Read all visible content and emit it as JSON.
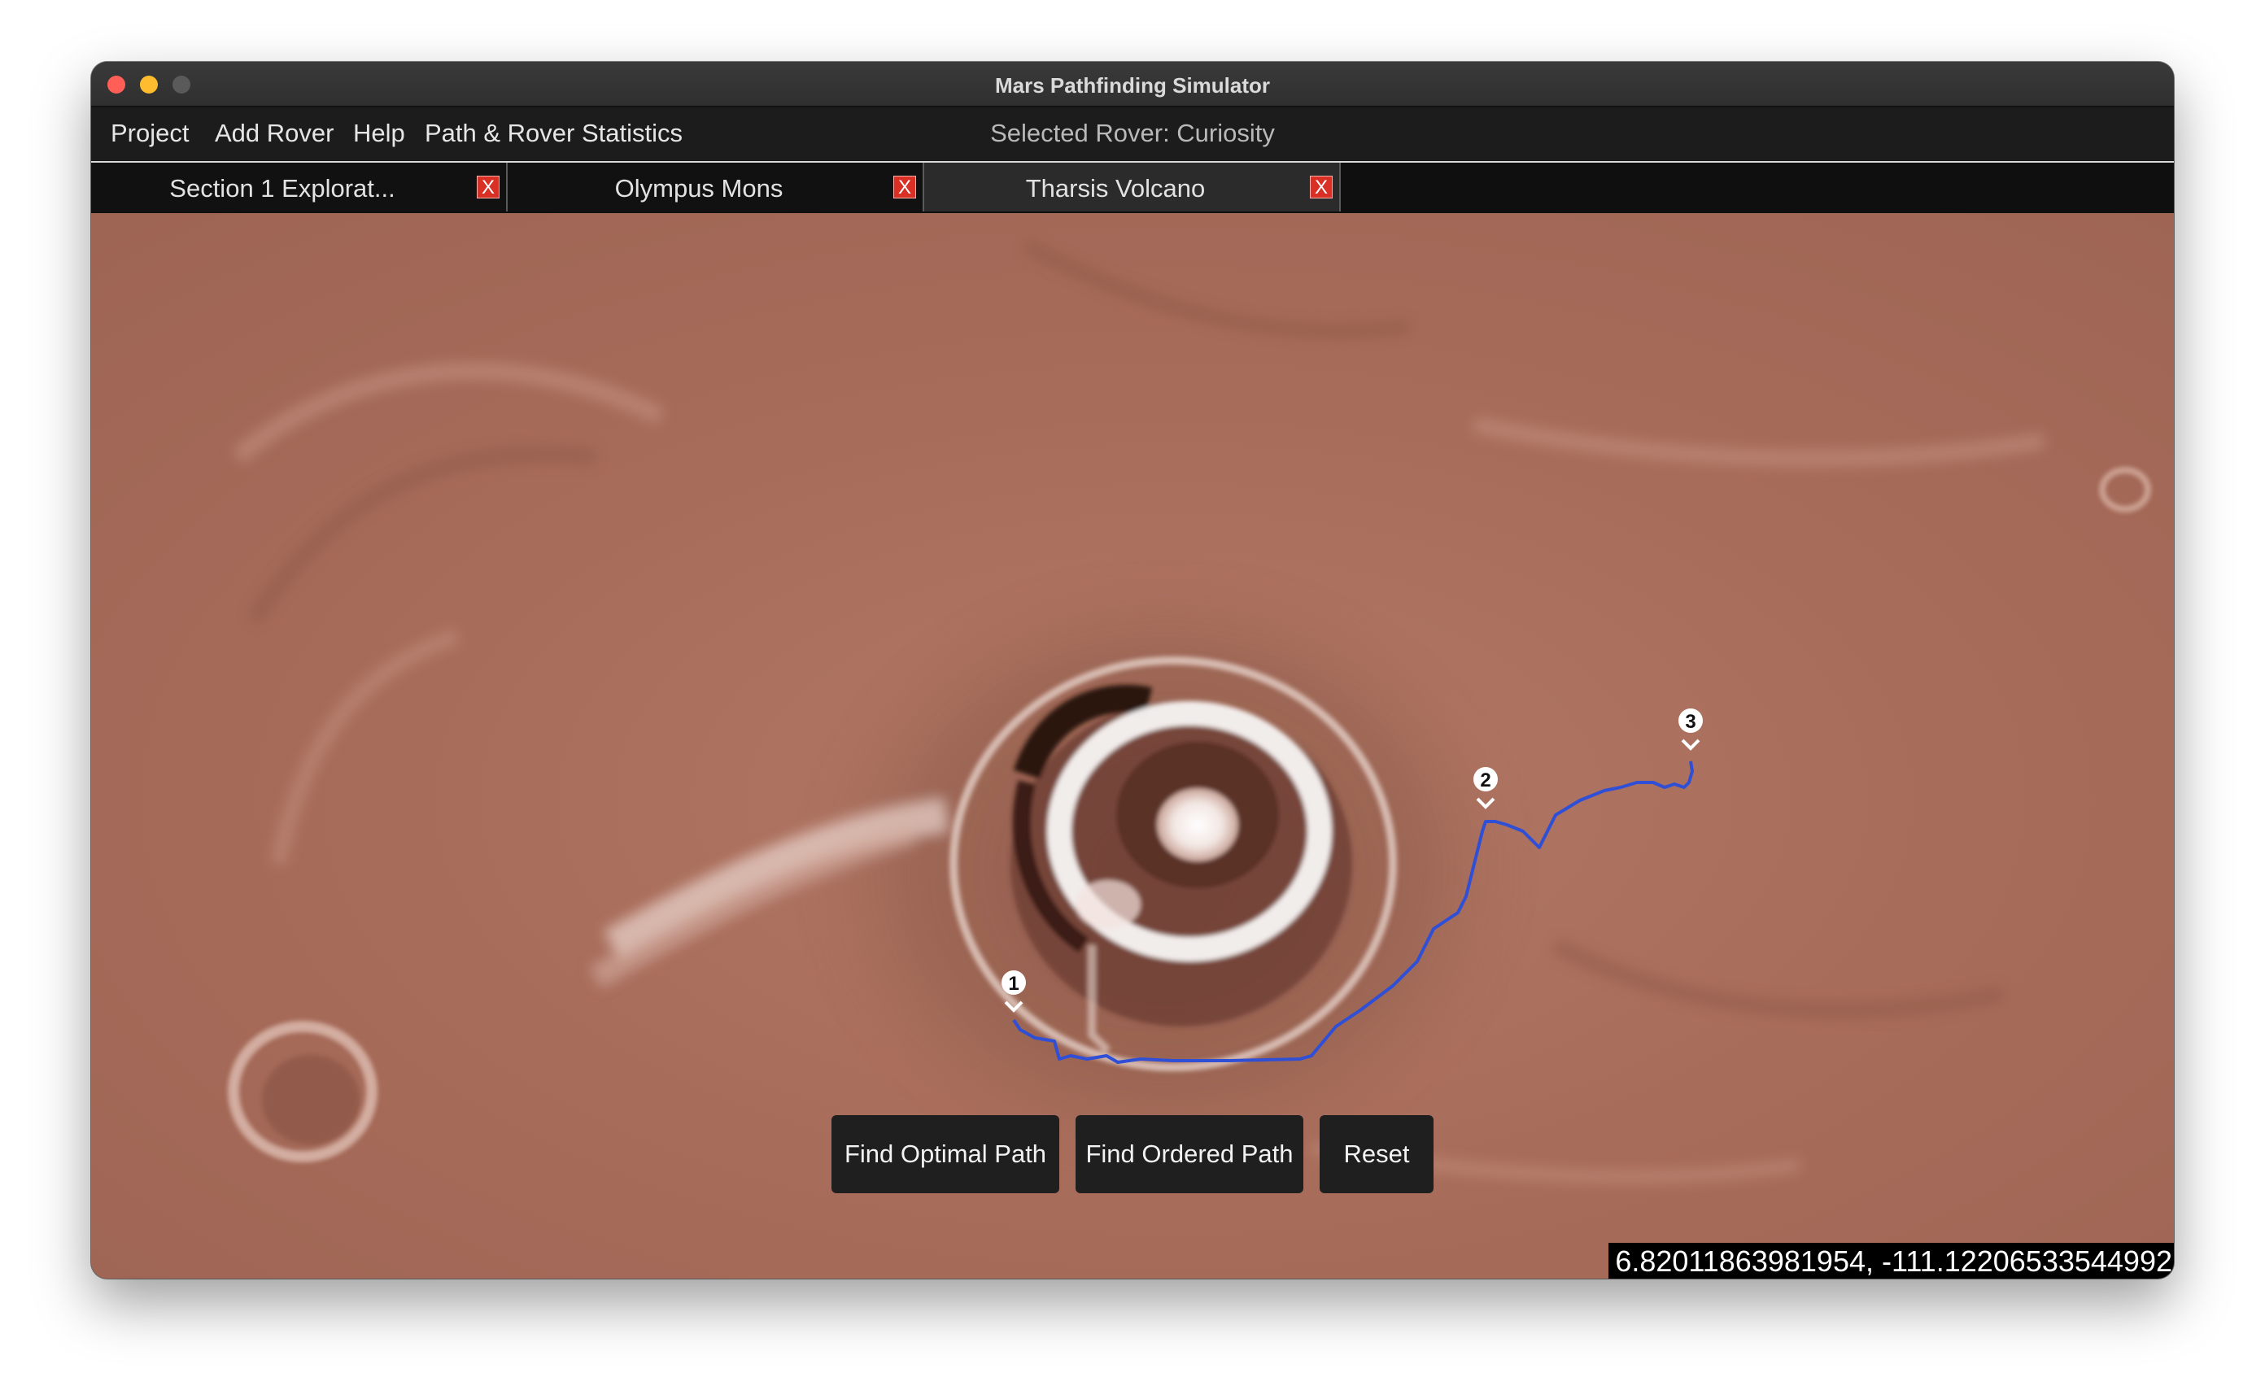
{
  "window": {
    "title": "Mars Pathfinding Simulator"
  },
  "menu": {
    "items": [
      "Project",
      "Add Rover",
      "Help",
      "Path & Rover Statistics"
    ],
    "selected_rover": "Selected Rover: Curiosity"
  },
  "tabs": [
    {
      "label": "Section 1 Explorat...",
      "close": "X",
      "active": false
    },
    {
      "label": "Olympus Mons",
      "close": "X",
      "active": false
    },
    {
      "label": "Tharsis Volcano",
      "close": "X",
      "active": true
    }
  ],
  "map": {
    "waypoints": [
      "1",
      "2",
      "3"
    ],
    "path_color": "#2f4fd6",
    "terrain_color": "#a66a58"
  },
  "actions": {
    "find_optimal": "Find Optimal Path",
    "find_ordered": "Find Ordered Path",
    "reset": "Reset"
  },
  "status": {
    "coordinates": "6.82011863981954, -111.12206533544992"
  },
  "colors": {
    "close_button": "#d93025",
    "traffic_red": "#ff5f57",
    "traffic_yellow": "#febc2e"
  }
}
